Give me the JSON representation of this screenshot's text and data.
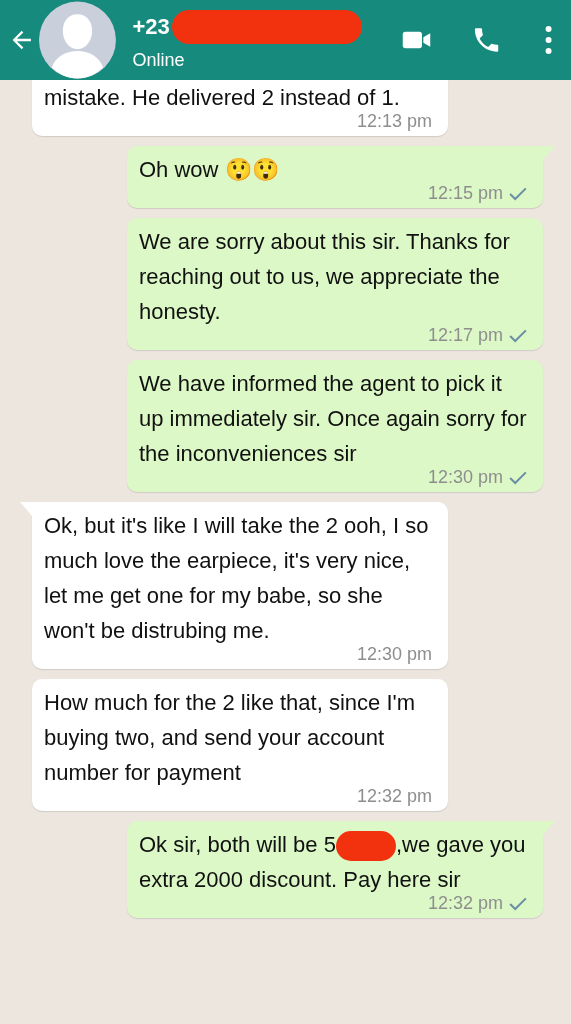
{
  "header": {
    "title": [
      {
        "kind": "text",
        "text": "+23"
      },
      {
        "kind": "redacted"
      }
    ],
    "status": "Online"
  },
  "messages": [
    {
      "kind": "in",
      "cut_top": true,
      "parts": [
        {
          "kind": "text",
          "text": "mistake. He delivered 2 instead of 1."
        }
      ],
      "time": "12:13 pm"
    },
    {
      "kind": "out",
      "tail": true,
      "parts": [
        {
          "kind": "text",
          "text": "Oh wow 😲😲"
        }
      ],
      "time": "12:15 pm",
      "ticked": true
    },
    {
      "kind": "out",
      "tail": false,
      "parts": [
        {
          "kind": "text",
          "text": "We are sorry about this sir. Thanks for reaching out to us, we appreciate the honesty."
        }
      ],
      "time": "12:17 pm",
      "ticked": true
    },
    {
      "kind": "out",
      "tail": false,
      "parts": [
        {
          "kind": "text",
          "text": "We have informed the agent to pick it up immediately sir. Once again sorry for the inconveniences sir"
        }
      ],
      "time": "12:30 pm",
      "ticked": true
    },
    {
      "kind": "in",
      "tail": true,
      "parts": [
        {
          "kind": "text",
          "text": "Ok, but it's like I will take the 2 ooh, I so much love the earpiece, it's very nice, let me get one for my babe, so she won't be distrubing me."
        }
      ],
      "time": "12:30 pm"
    },
    {
      "kind": "in",
      "tail": false,
      "parts": [
        {
          "kind": "text",
          "text": "How much for the 2 like that, since I'm buying two, and send your account number for payment"
        }
      ],
      "time": "12:32 pm"
    },
    {
      "kind": "out",
      "tail": true,
      "parts": [
        {
          "kind": "text",
          "text": "Ok sir, both will be 5"
        },
        {
          "kind": "redacted"
        },
        {
          "kind": "text",
          "text": ",we gave you extra 2000 discount. Pay here sir"
        }
      ],
      "time": "12:32 pm",
      "ticked": true
    }
  ]
}
